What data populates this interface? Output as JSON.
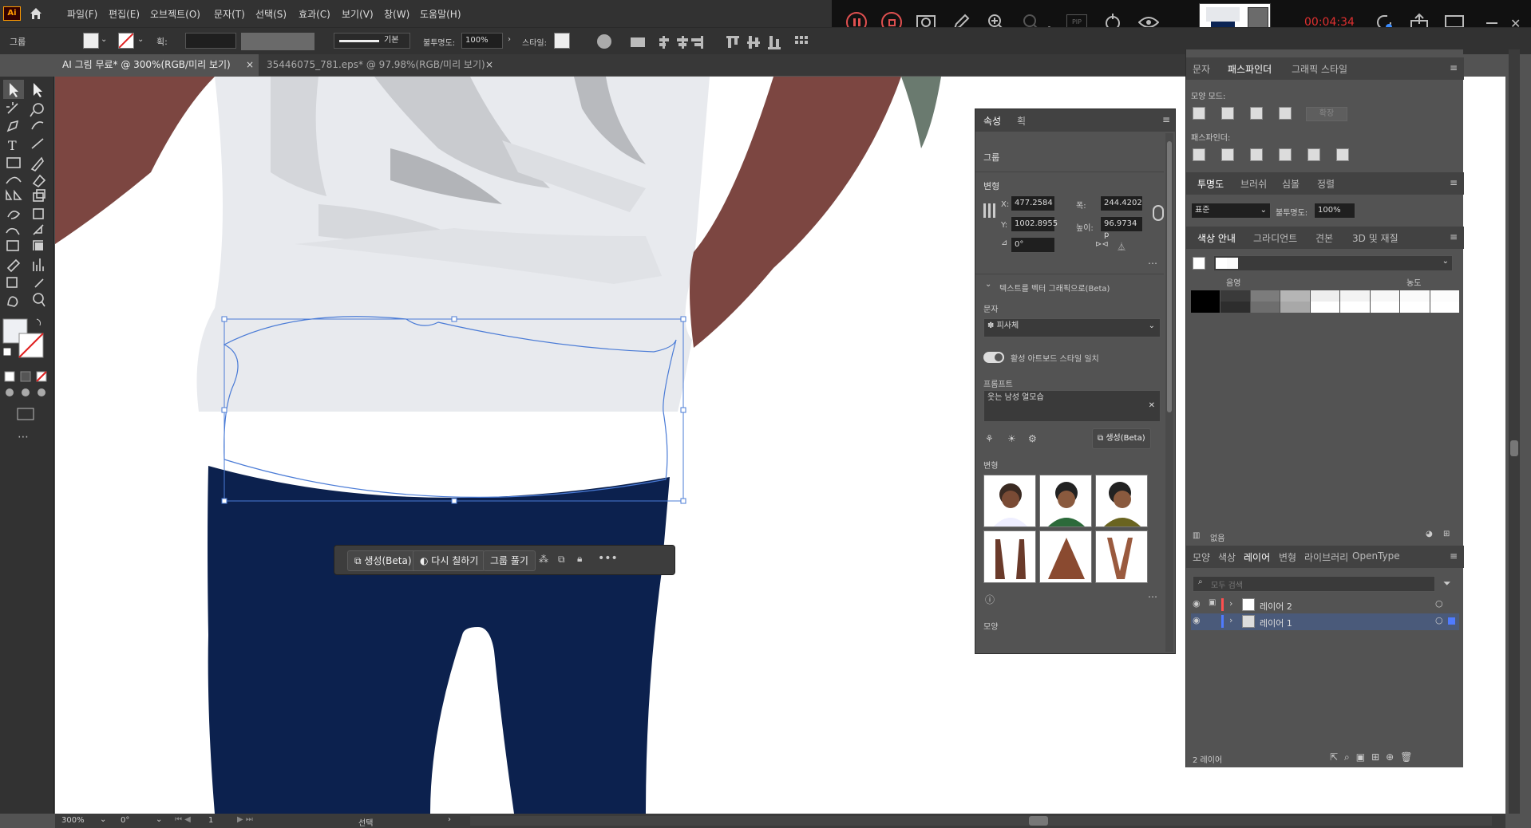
{
  "app": {
    "logo": "Ai"
  },
  "menu": [
    "파일(F)",
    "편집(E)",
    "오브젝트(O)",
    "문자(T)",
    "선택(S)",
    "효과(C)",
    "보기(V)",
    "창(W)",
    "도움말(H)"
  ],
  "control_bar": {
    "selection_label": "그룹",
    "stroke_label": "획:",
    "brush_label": "기본",
    "opacity_label": "불투명도:",
    "opacity_value": "100%",
    "style_label": "스타일:"
  },
  "tabs": [
    {
      "label": "AI 그림 무료* @ 300%(RGB/미리 보기)"
    },
    {
      "label": "35446075_781.eps* @ 97.98%(RGB/미리 보기)"
    }
  ],
  "recording": {
    "timer": "00:04:34",
    "zoom_label": "x1",
    "pip_label": "PIP"
  },
  "properties": {
    "tabs": [
      "속성",
      "획"
    ],
    "group_label": "그룹",
    "transform_label": "변형",
    "x_label": "X:",
    "x_value": "477.2584",
    "y_label": "Y:",
    "y_value": "1002.8955",
    "w_label": "폭:",
    "w_value": "244.4202",
    "h_label": "높이:",
    "h_value": "96.9734 p",
    "angle_value": "0°",
    "text_to_vector_label": "텍스트를 벡터 그래픽으로(Beta)",
    "type_label": "문자",
    "type_value": "피사체",
    "match_style_label": "활성 아트보드 스타일 일치",
    "prompt_label": "프롬프트",
    "prompt_value": "웃는 남성 얼모습",
    "generate_label": "생성(Beta)",
    "variations_label": "변형",
    "appearance_label": "모양"
  },
  "pathfinder": {
    "tabs": [
      "문자",
      "패스파인더",
      "그래픽 스타일"
    ],
    "shape_modes_label": "모양 모드:",
    "expand_label": "확장",
    "pathfinders_label": "패스파인더:"
  },
  "transparency": {
    "tabs": [
      "투명도",
      "브러쉬",
      "심볼",
      "정렬"
    ],
    "blend_mode": "표준",
    "opacity_label": "불투명도:",
    "opacity_value": "100%"
  },
  "color_guide": {
    "tabs": [
      "색상 안내",
      "그라디언트",
      "견본",
      "3D 및 재질"
    ],
    "shade_label": "음영",
    "tint_label": "농도",
    "none_label": "없음",
    "colors_row1": [
      "#000000",
      "#3a3a3a",
      "#7c7c7c",
      "#b5b5b5",
      "#eeeeee",
      "#f3f3f3",
      "#f7f7f7",
      "#fafafa",
      "#fcfcfc"
    ],
    "colors_row2": [
      "#000000",
      "#2d2d2d",
      "#6e6e6e",
      "#a8a8a8",
      "#ffffff",
      "#ffffff",
      "#ffffff",
      "#ffffff",
      "#ffffff"
    ]
  },
  "layers": {
    "tabs": [
      "모양",
      "색상",
      "레이어",
      "변형",
      "라이브러리",
      "OpenType"
    ],
    "search_placeholder": "모두 검색",
    "items": [
      {
        "name": "레이어 2",
        "color": "#ff4f4f"
      },
      {
        "name": "레이어 1",
        "color": "#4f7bff"
      }
    ],
    "count_label": "2 레이어"
  },
  "context_bar": {
    "generate": "생성(Beta)",
    "recolor": "다시 칠하기",
    "ungroup": "그룹 풀기"
  },
  "status": {
    "zoom": "300%",
    "angle": "0°",
    "artboard": "1",
    "tool": "선택"
  }
}
